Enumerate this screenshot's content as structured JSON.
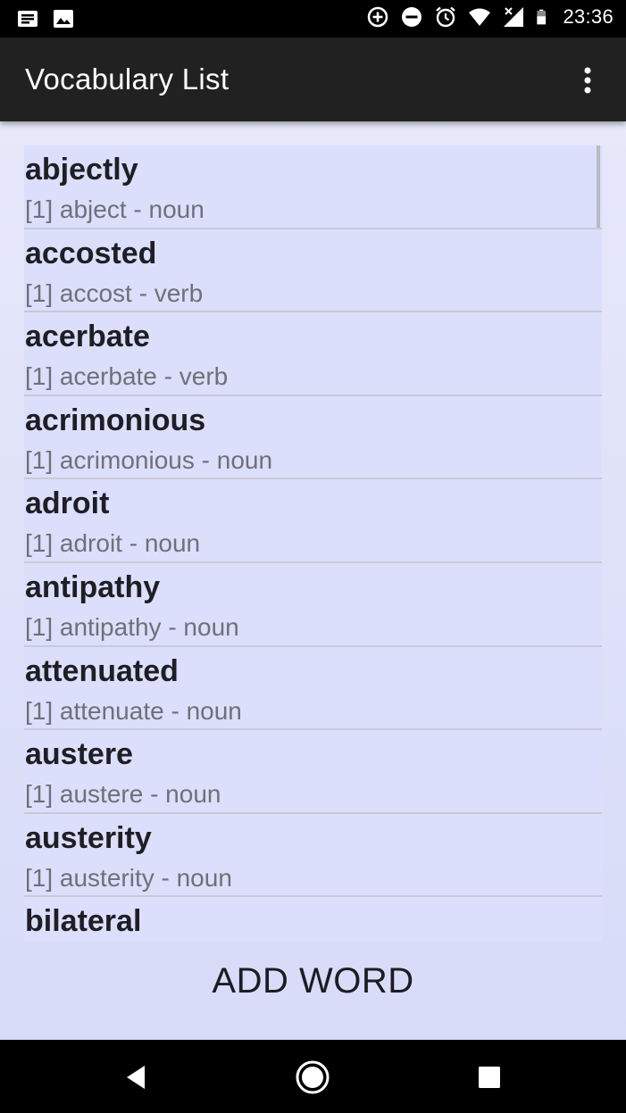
{
  "status_bar": {
    "time": "23:36",
    "left_icons": [
      "notification-icon",
      "image-icon"
    ],
    "right_icons": [
      "data-saver-icon",
      "do-not-disturb-icon",
      "alarm-icon",
      "wifi-icon",
      "signal-icon",
      "battery-icon"
    ]
  },
  "app_bar": {
    "title": "Vocabulary List",
    "menu_icon": "more-vert-icon"
  },
  "words": [
    {
      "word": "abjectly",
      "detail": "[1] abject - noun"
    },
    {
      "word": "accosted",
      "detail": "[1] accost - verb"
    },
    {
      "word": "acerbate",
      "detail": "[1] acerbate - verb"
    },
    {
      "word": "acrimonious",
      "detail": "[1] acrimonious - noun"
    },
    {
      "word": "adroit",
      "detail": "[1] adroit - noun"
    },
    {
      "word": "antipathy",
      "detail": "[1] antipathy - noun"
    },
    {
      "word": "attenuated",
      "detail": "[1] attenuate - noun"
    },
    {
      "word": "austere",
      "detail": "[1] austere - noun"
    },
    {
      "word": "austerity",
      "detail": "[1] austerity - noun"
    },
    {
      "word": "bilateral",
      "detail": ""
    }
  ],
  "actions": {
    "add_word_label": "ADD WORD"
  },
  "nav_bar": {
    "icons": [
      "back-icon",
      "home-icon",
      "recents-icon"
    ]
  },
  "colors": {
    "app_bar": "#212121",
    "background": "#e5e6f8",
    "list_background": "#dcdffb",
    "word_text": "#1e1e24",
    "detail_text": "#6f7078"
  }
}
